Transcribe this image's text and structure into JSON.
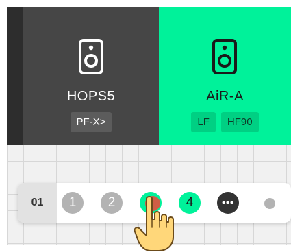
{
  "speakers": [
    {
      "name": "HOPS5",
      "tags": [
        "PF-X>"
      ],
      "state": "inactive"
    },
    {
      "name": "AiR-A",
      "tags": [
        "LF",
        "HF90"
      ],
      "state": "active"
    }
  ],
  "toolbar": {
    "page_label": "01",
    "buttons": [
      {
        "label": "1",
        "state": "off"
      },
      {
        "label": "2",
        "state": "off"
      },
      {
        "label": "",
        "state": "on-touched"
      },
      {
        "label": "4",
        "state": "on"
      },
      {
        "label": "•••",
        "state": "more"
      }
    ]
  },
  "icons": {
    "speaker": "speaker-icon",
    "more": "more-icon",
    "pointer": "hand-pointer-icon"
  },
  "colors": {
    "accent": "#00f29a",
    "dark_panel": "#464646",
    "inactive_circle": "#b3b3b3",
    "touch": "#e74c3c"
  }
}
